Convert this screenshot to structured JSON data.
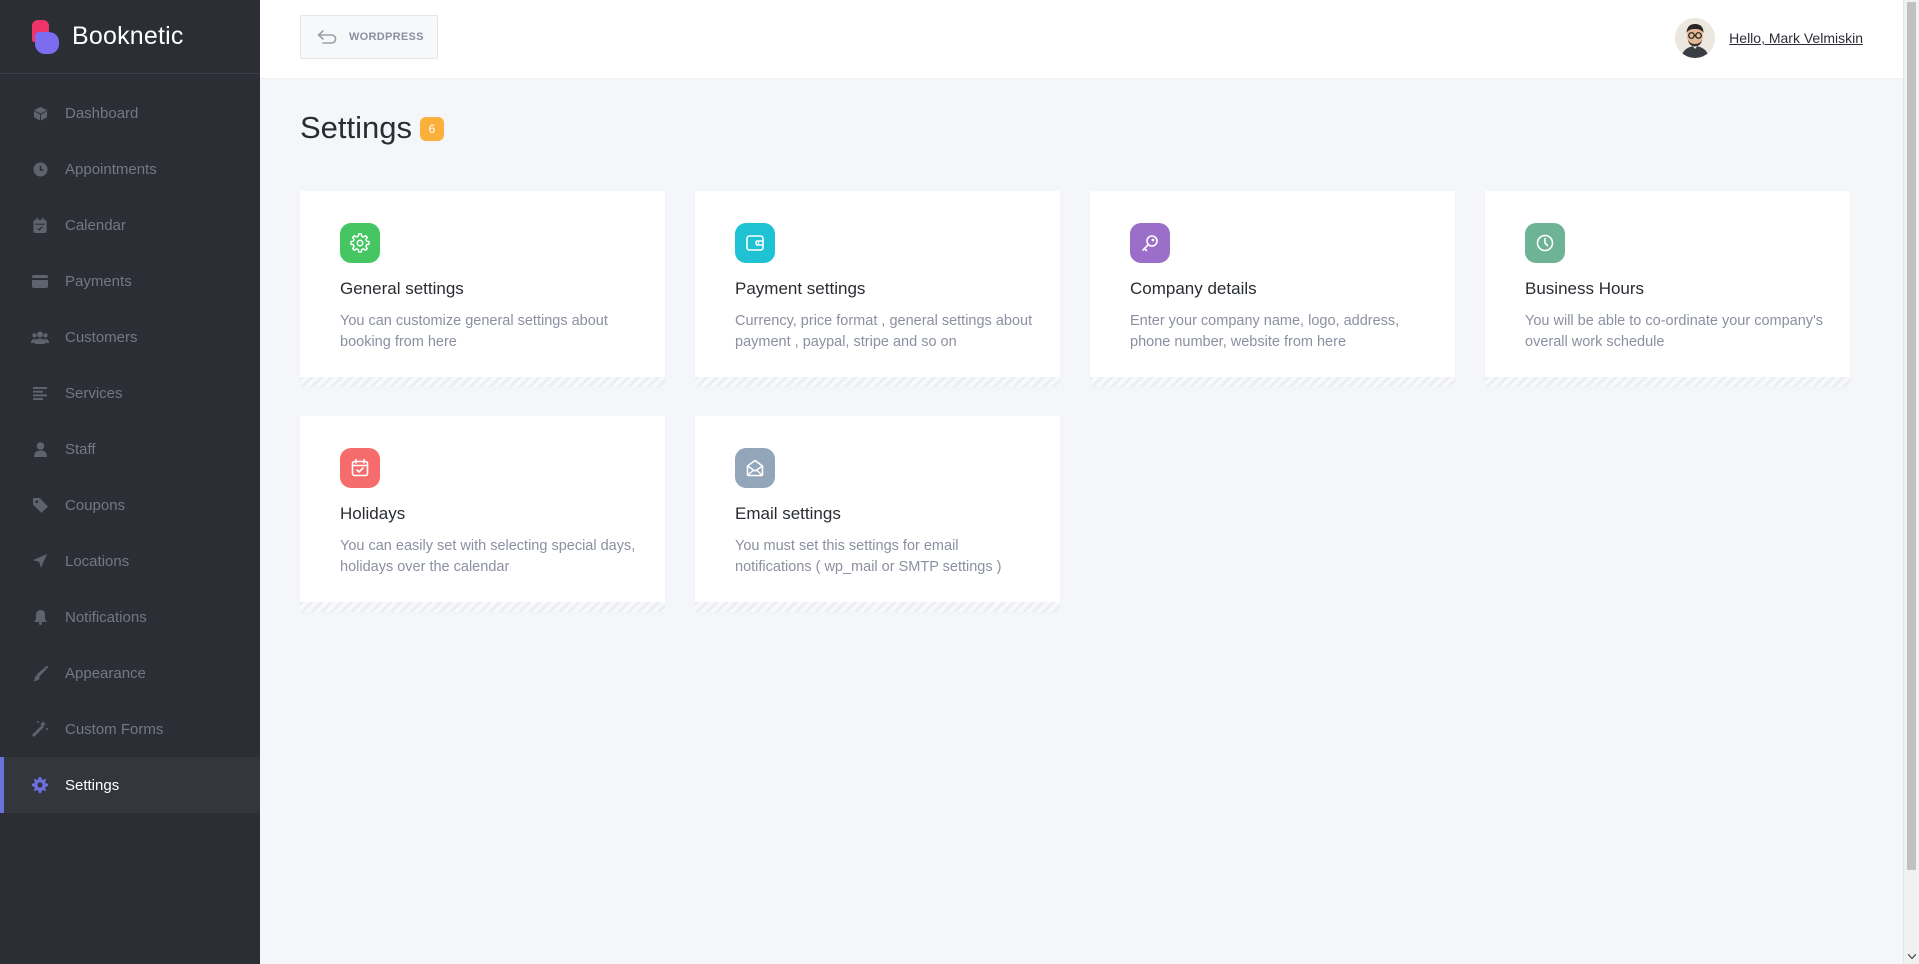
{
  "sidebar": {
    "brand": "Booknetic",
    "items": [
      {
        "label": "Dashboard",
        "icon": "cube-icon"
      },
      {
        "label": "Appointments",
        "icon": "clock-icon"
      },
      {
        "label": "Calendar",
        "icon": "calendar-icon"
      },
      {
        "label": "Payments",
        "icon": "card-icon"
      },
      {
        "label": "Customers",
        "icon": "users-icon"
      },
      {
        "label": "Services",
        "icon": "list-icon"
      },
      {
        "label": "Staff",
        "icon": "person-icon"
      },
      {
        "label": "Coupons",
        "icon": "tag-icon"
      },
      {
        "label": "Locations",
        "icon": "location-arrow-icon"
      },
      {
        "label": "Notifications",
        "icon": "bell-icon"
      },
      {
        "label": "Appearance",
        "icon": "brush-icon"
      },
      {
        "label": "Custom Forms",
        "icon": "magic-wand-icon"
      },
      {
        "label": "Settings",
        "icon": "gear-icon",
        "active": true
      }
    ]
  },
  "topbar": {
    "wordpress_label": "WORDPRESS",
    "user_greeting": "Hello, Mark Velmiskin"
  },
  "page": {
    "title": "Settings",
    "badge": "6"
  },
  "cards": [
    {
      "title": "General settings",
      "desc": "You can customize general settings about booking from here",
      "icon": "gear-icon",
      "color": "#46c563"
    },
    {
      "title": "Payment settings",
      "desc": "Currency, price format , general settings about payment , paypal, stripe and so on",
      "icon": "wallet-icon",
      "color": "#1ec2d3"
    },
    {
      "title": "Company details",
      "desc": "Enter your company name, logo, address, phone number, website from here",
      "icon": "key-icon",
      "color": "#9b6ec9"
    },
    {
      "title": "Business Hours",
      "desc": "You will be able to co-ordinate your company's overall work schedule",
      "icon": "clock-icon",
      "color": "#6fb396"
    },
    {
      "title": "Holidays",
      "desc": "You can easily set with selecting special days, holidays over the calendar",
      "icon": "calendar-check-icon",
      "color": "#f66b6b"
    },
    {
      "title": "Email settings",
      "desc": "You must set this settings for email notifications ( wp_mail or SMTP settings )",
      "icon": "envelope-open-icon",
      "color": "#93a5b8"
    }
  ],
  "colors": {
    "sidebar_bg": "#2b2e35",
    "accent": "#6c70dc",
    "badge": "#fbb03b"
  }
}
